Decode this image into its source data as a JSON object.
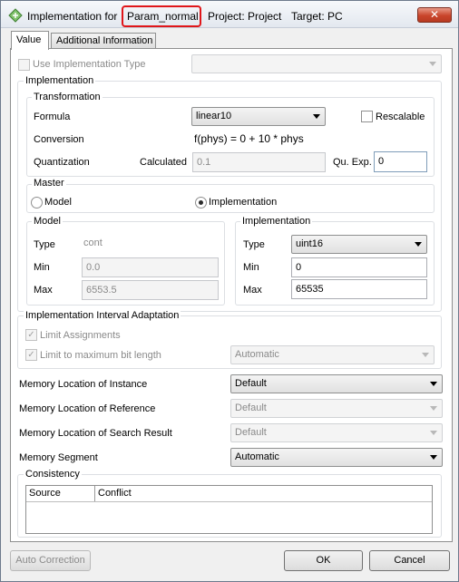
{
  "window": {
    "title_prefix": "Implementation for",
    "param_name": "Param_normal",
    "project": "Project: Project",
    "target": "Target: PC",
    "close_symbol": "✕"
  },
  "tabs": [
    {
      "label": "Value",
      "active": true
    },
    {
      "label": "Additional Information",
      "active": false
    }
  ],
  "use_impl_type": {
    "label": "Use Implementation Type",
    "checked": false,
    "value": ""
  },
  "implementation": {
    "group_label": "Implementation",
    "transformation": {
      "group_label": "Transformation",
      "formula_label": "Formula",
      "formula_value": "linear10",
      "rescalable_label": "Rescalable",
      "rescalable_checked": false,
      "conversion_label": "Conversion",
      "conversion_value": "f(phys) = 0 + 10 * phys",
      "quantization_label": "Quantization",
      "calculated_label": "Calculated",
      "calculated_value": "0.1",
      "qu_exp_label": "Qu. Exp.",
      "qu_exp_value": "0"
    }
  },
  "master": {
    "group_label": "Master",
    "model_label": "Model",
    "implementation_label": "Implementation",
    "selected": "Implementation"
  },
  "model_panel": {
    "group_label": "Model",
    "type_label": "Type",
    "type_value": "cont",
    "min_label": "Min",
    "min_value": "0.0",
    "max_label": "Max",
    "max_value": "6553.5"
  },
  "impl_panel": {
    "group_label": "Implementation",
    "type_label": "Type",
    "type_value": "uint16",
    "min_label": "Min",
    "min_value": "0",
    "max_label": "Max",
    "max_value": "65535"
  },
  "interval": {
    "group_label": "Implementation Interval Adaptation",
    "limit_assignments": "Limit Assignments",
    "limit_bitlength": "Limit to maximum bit length",
    "bitlength_value": "Automatic",
    "check_mark": "✓"
  },
  "memory": {
    "instance_label": "Memory Location of Instance",
    "instance_value": "Default",
    "reference_label": "Memory Location of Reference",
    "reference_value": "Default",
    "search_label": "Memory Location of Search Result",
    "search_value": "Default",
    "segment_label": "Memory Segment",
    "segment_value": "Automatic"
  },
  "consistency": {
    "group_label": "Consistency",
    "columns": [
      "Source",
      "Conflict"
    ]
  },
  "buttons": {
    "auto_correction": "Auto Correction",
    "ok": "OK",
    "cancel": "Cancel"
  },
  "colors": {
    "highlight": "#e0161a",
    "close_button": "#c9452b"
  }
}
